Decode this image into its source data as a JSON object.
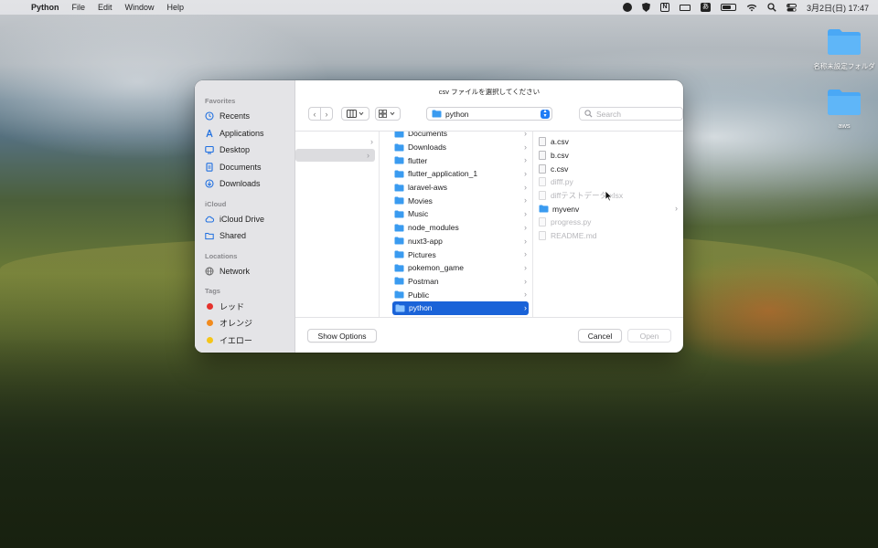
{
  "menubar": {
    "app_name": "Python",
    "menus": [
      "File",
      "Edit",
      "Window",
      "Help"
    ],
    "input_indicator": "あ",
    "notion_glyph": "N",
    "clock": "3月2日(日)  17:47"
  },
  "desktop": {
    "icons": [
      {
        "label": "名称未設定フォルダ"
      },
      {
        "label": "aws"
      }
    ]
  },
  "dialog": {
    "title": "csv ファイルを選択してください",
    "sidebar": {
      "favorites_header": "Favorites",
      "favorites": [
        "Recents",
        "Applications",
        "Desktop",
        "Documents",
        "Downloads"
      ],
      "icloud_header": "iCloud",
      "icloud": [
        "iCloud Drive",
        "Shared"
      ],
      "locations_header": "Locations",
      "locations": [
        "Network"
      ],
      "tags_header": "Tags",
      "tags": [
        {
          "label": "レッド",
          "color": "#e5322d"
        },
        {
          "label": "オレンジ",
          "color": "#f28b1e"
        },
        {
          "label": "イエロー",
          "color": "#f5c518"
        }
      ]
    },
    "toolbar": {
      "back": "‹",
      "forward": "›",
      "path": "python",
      "search_placeholder": "Search"
    },
    "column2": [
      "Documents",
      "Downloads",
      "flutter",
      "flutter_application_1",
      "laravel-aws",
      "Movies",
      "Music",
      "node_modules",
      "nuxt3-app",
      "Pictures",
      "pokemon_game",
      "Postman",
      "Public",
      "python"
    ],
    "column2_selected": "python",
    "column3": [
      {
        "name": "a.csv",
        "kind": "file",
        "enabled": true
      },
      {
        "name": "b.csv",
        "kind": "file",
        "enabled": true
      },
      {
        "name": "c.csv",
        "kind": "file",
        "enabled": true
      },
      {
        "name": "difff.py",
        "kind": "file",
        "enabled": false
      },
      {
        "name": "diffテストデータ.xlsx",
        "kind": "file",
        "enabled": false
      },
      {
        "name": "myvenv",
        "kind": "folder",
        "enabled": true
      },
      {
        "name": "progress.py",
        "kind": "file",
        "enabled": false
      },
      {
        "name": "README.md",
        "kind": "file",
        "enabled": false
      }
    ],
    "buttons": {
      "show_options": "Show Options",
      "cancel": "Cancel",
      "open": "Open"
    },
    "colors": {
      "accent": "#1a63d8",
      "folder": "#3a9bf0"
    }
  }
}
